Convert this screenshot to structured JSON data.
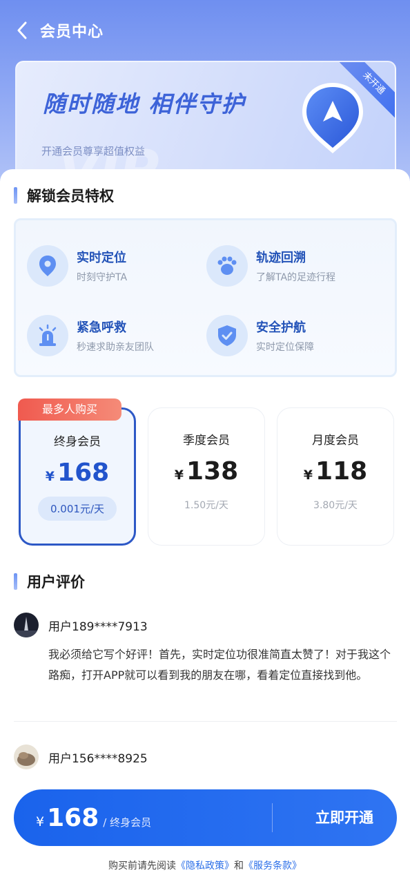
{
  "header": {
    "title": "会员中心"
  },
  "banner": {
    "slogan": "随时随地 相伴守护",
    "subtitle": "开通会员尊享超值权益",
    "watermark": "VIP",
    "status_ribbon": "未开通"
  },
  "privileges": {
    "title": "解锁会员特权",
    "items": [
      {
        "title": "实时定位",
        "desc": "时刻守护TA",
        "icon": "location-pin-icon"
      },
      {
        "title": "轨迹回溯",
        "desc": "了解TA的足迹行程",
        "icon": "footprint-icon"
      },
      {
        "title": "紧急呼救",
        "desc": "秒速求助亲友团队",
        "icon": "siren-icon"
      },
      {
        "title": "安全护航",
        "desc": "实时定位保障",
        "icon": "shield-check-icon"
      }
    ]
  },
  "plans": {
    "tag": "最多人购买",
    "items": [
      {
        "name": "终身会员",
        "currency": "¥",
        "price": "168",
        "daily": "0.001元/天"
      },
      {
        "name": "季度会员",
        "currency": "¥",
        "price": "138",
        "daily": "1.50元/天"
      },
      {
        "name": "月度会员",
        "currency": "¥",
        "price": "118",
        "daily": "3.80元/天"
      }
    ]
  },
  "reviews": {
    "title": "用户评价",
    "items": [
      {
        "user": "用户189****7913",
        "text": "我必须给它写个好评！首先，实时定位功很准简直太赞了！对于我这个路痴，打开APP就可以看到我的朋友在哪，看着定位直接找到他。"
      },
      {
        "user": "用户156****8925",
        "text": ""
      }
    ]
  },
  "buy_bar": {
    "currency": "¥",
    "price": "168",
    "plan_label": "/ 终身会员",
    "button": "立即开通"
  },
  "agreement": {
    "prefix": "购买前请先阅读",
    "privacy": "《隐私政策》",
    "and": "和",
    "terms": "《服务条款》"
  },
  "colors": {
    "accent": "#1a63ec",
    "tag": "#f05a4f",
    "selected_border": "#2d58c6"
  }
}
